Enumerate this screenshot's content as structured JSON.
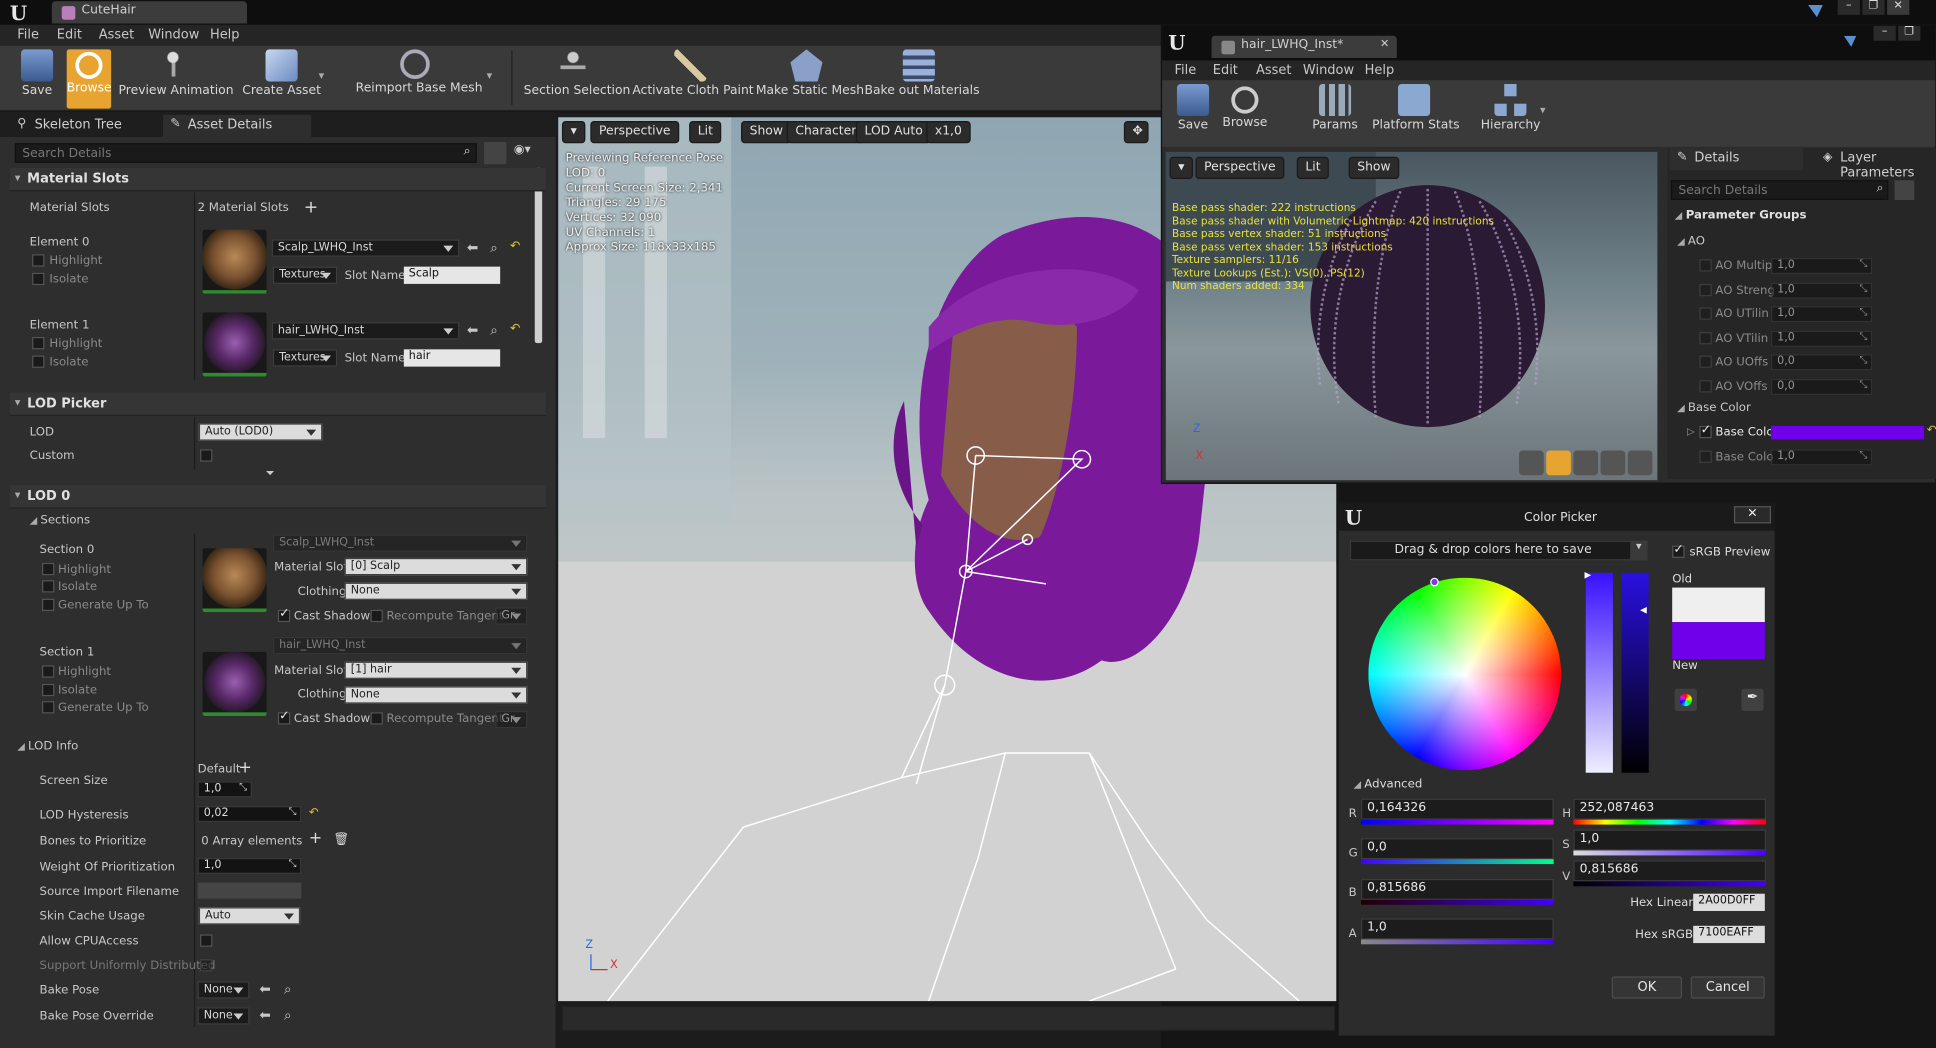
{
  "main_window": {
    "tab_title": "CuteHair",
    "menu": [
      "File",
      "Edit",
      "Asset",
      "Window",
      "Help"
    ],
    "toolbar": [
      {
        "label": "Save",
        "icon": "save-icon"
      },
      {
        "label": "Browse",
        "icon": "browse-icon"
      },
      {
        "label": "Preview Animation",
        "icon": "preview-animation-icon"
      },
      {
        "label": "Create Asset",
        "icon": "create-asset-icon"
      },
      {
        "label": "Reimport Base Mesh",
        "icon": "reimport-icon"
      },
      {
        "label": "Section Selection",
        "icon": "section-selection-icon"
      },
      {
        "label": "Activate Cloth Paint",
        "icon": "cloth-paint-icon"
      },
      {
        "label": "Make Static Mesh",
        "icon": "static-mesh-icon"
      },
      {
        "label": "Bake out Materials",
        "icon": "bake-materials-icon"
      }
    ]
  },
  "left_panel": {
    "tabs": [
      "Skeleton Tree",
      "Asset Details"
    ],
    "search_placeholder": "Search Details",
    "material_slots": {
      "header": "Material Slots",
      "label": "Material Slots",
      "count": "2 Material Slots",
      "elements": [
        {
          "name": "Element 0",
          "material": "Scalp_LWHQ_Inst",
          "textures": "Textures",
          "slot_name_label": "Slot Name",
          "slot_name": "Scalp"
        },
        {
          "name": "Element 1",
          "material": "hair_LWHQ_Inst",
          "textures": "Textures",
          "slot_name_label": "Slot Name",
          "slot_name": "hair"
        }
      ],
      "highlight": "Highlight",
      "isolate": "Isolate"
    },
    "lod_picker": {
      "header": "LOD Picker",
      "lod_label": "LOD",
      "lod_value": "Auto (LOD0)",
      "custom_label": "Custom"
    },
    "lod0": {
      "header": "LOD 0",
      "sections_header": "Sections",
      "sections": [
        {
          "name": "Section 0",
          "material": "Scalp_LWHQ_Inst",
          "material_slot": "[0] Scalp",
          "clothing": "None"
        },
        {
          "name": "Section 1",
          "material": "hair_LWHQ_Inst",
          "material_slot": "[1] hair",
          "clothing": "None"
        }
      ],
      "labels": {
        "highlight": "Highlight",
        "isolate": "Isolate",
        "generate_up_to": "Generate Up To",
        "material_slot": "Material Slot",
        "clothing": "Clothing",
        "cast_shadows": "Cast Shadows",
        "recompute_tangent": "Recompute Tangent",
        "gr": "Gr"
      },
      "lod_info": {
        "header": "LOD Info",
        "screen_size": "Screen Size",
        "default": "Default",
        "screen_size_value": "1,0",
        "lod_hysteresis": "LOD Hysteresis",
        "lod_hysteresis_value": "0,02",
        "bones_to_prioritize": "Bones to Prioritize",
        "bones_value": "0 Array elements",
        "weight_of_prioritization": "Weight Of Prioritization",
        "weight_value": "1,0",
        "source_import_filename": "Source Import Filename",
        "skin_cache_usage": "Skin Cache Usage",
        "skin_cache_value": "Auto",
        "allow_cpu_access": "Allow CPUAccess",
        "support_uniformly_distributed": "Support Uniformly Distributed",
        "bake_pose": "Bake Pose",
        "bake_pose_value": "None",
        "bake_pose_override": "Bake Pose Override",
        "bake_pose_override_value": "None"
      }
    }
  },
  "viewport": {
    "buttons": [
      "Perspective",
      "Lit",
      "Show",
      "Character",
      "LOD Auto",
      "x1,0"
    ],
    "info": [
      "Previewing Reference Pose",
      "LOD: 0",
      "Current Screen Size: 2,341",
      "Triangles: 29 175",
      "Vertices: 32 090",
      "UV Channels: 1",
      "Approx Size: 118x33x185"
    ]
  },
  "material_window": {
    "tab_title": "hair_LWHQ_Inst*",
    "menu": [
      "File",
      "Edit",
      "Asset",
      "Window",
      "Help"
    ],
    "toolbar": [
      {
        "label": "Save",
        "icon": "save-icon"
      },
      {
        "label": "Browse",
        "icon": "browse-icon"
      },
      {
        "label": "Params",
        "icon": "params-icon"
      },
      {
        "label": "Platform Stats",
        "icon": "platform-stats-icon"
      },
      {
        "label": "Hierarchy",
        "icon": "hierarchy-icon"
      }
    ],
    "viewport_buttons": [
      "Perspective",
      "Lit",
      "Show"
    ],
    "stats": [
      "Base pass shader: 222 instructions",
      "Base pass shader with Volumetric Lightmap: 420 instructions",
      "Base pass vertex shader: 51 instructions",
      "Base pass vertex shader: 153 instructions",
      "Texture samplers: 11/16",
      "Texture Lookups (Est.): VS(0), PS(12)",
      "Num shaders added: 334"
    ],
    "tabs": [
      "Details",
      "Layer Parameters"
    ],
    "search_placeholder": "Search Details",
    "parameter_groups": "Parameter Groups",
    "ao_group": "AO",
    "ao_params": [
      {
        "name": "AO Multip",
        "value": "1,0"
      },
      {
        "name": "AO Streng",
        "value": "1,0"
      },
      {
        "name": "AO UTilin",
        "value": "1,0"
      },
      {
        "name": "AO VTilin",
        "value": "1,0"
      },
      {
        "name": "AO UOffs",
        "value": "0,0"
      },
      {
        "name": "AO VOffs",
        "value": "0,0"
      }
    ],
    "base_color_group": "Base Color",
    "base_color_params": [
      {
        "name": "Base Colc"
      },
      {
        "name": "Base Colo",
        "value": "1,0"
      }
    ]
  },
  "color_picker": {
    "title": "Color Picker",
    "swatch_drop": "Drag & drop colors here to save",
    "srgb_preview": "sRGB Preview",
    "old_label": "Old",
    "new_label": "New",
    "advanced": "Advanced",
    "channels_left": [
      {
        "label": "R",
        "value": "0,164326"
      },
      {
        "label": "G",
        "value": "0,0"
      },
      {
        "label": "B",
        "value": "0,815686"
      },
      {
        "label": "A",
        "value": "1,0"
      }
    ],
    "channels_right": [
      {
        "label": "H",
        "value": "252,087463"
      },
      {
        "label": "S",
        "value": "1,0"
      },
      {
        "label": "V",
        "value": "0,815686"
      }
    ],
    "hex_linear_label": "Hex Linear",
    "hex_linear": "2A00D0FF",
    "hex_srgb_label": "Hex sRGB",
    "hex_srgb": "7100EAFF",
    "ok": "OK",
    "cancel": "Cancel"
  },
  "colors": {
    "accent_orange": "#e8a430",
    "new_color": "#7100EA",
    "old_color": "#efefef",
    "hair": "#7a1a9a"
  }
}
